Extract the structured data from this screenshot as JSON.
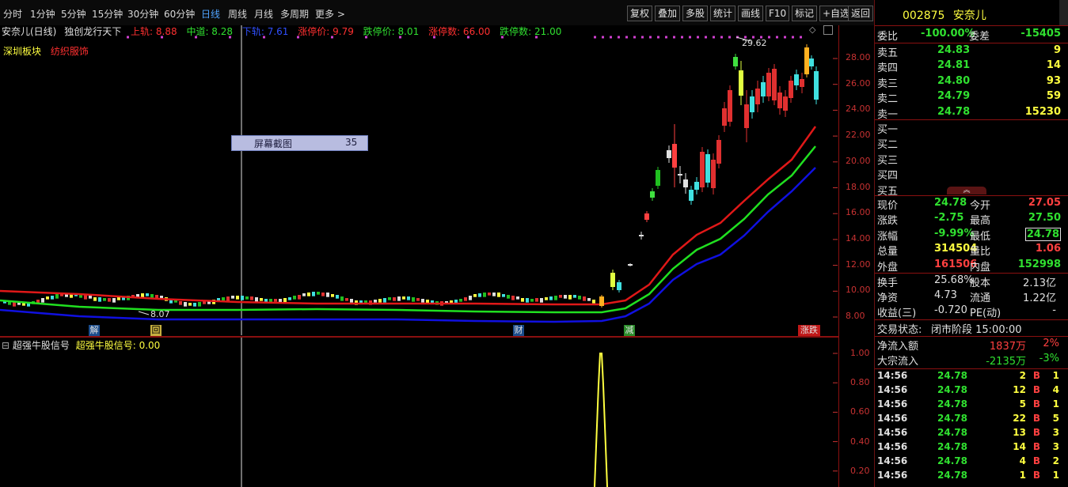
{
  "toolbar": {
    "periods": [
      "分时",
      "1分钟",
      "5分钟",
      "15分钟",
      "30分钟",
      "60分钟",
      "日线",
      "周线",
      "月线",
      "多周期",
      "更多 >"
    ],
    "active_period": "日线",
    "buttons": [
      "复权",
      "叠加",
      "多股",
      "统计",
      "画线",
      "F10",
      "标记",
      "+自选",
      "返回"
    ]
  },
  "chart_header": {
    "stock_label": "安奈儿(日线)",
    "indicator_name": "独创龙行天下",
    "upper_text": "上轨: 8.88",
    "middle_text": "中道: 8.28",
    "lower_text": "下轨: 7.61",
    "limit_up_price_text": "涨停价: 9.79",
    "limit_down_price_text": "跌停价: 8.01",
    "limit_up_count_text": "涨停数: 66.00",
    "limit_down_count_text": "跌停数: 21.00"
  },
  "sector_tags": [
    "深圳板块",
    "纺织服饰"
  ],
  "screenshot_tooltip": {
    "label": "屏幕截图",
    "value": "35"
  },
  "price_axis": [
    "28.00",
    "26.00",
    "24.00",
    "22.00",
    "20.00",
    "18.00",
    "16.00",
    "14.00",
    "12.00",
    "10.00",
    "8.00"
  ],
  "annotations": {
    "high_label": "29.62",
    "low_label": "8.07"
  },
  "event_markers": [
    "解",
    "回",
    "财",
    "减",
    "涨跌"
  ],
  "lower_indicator": {
    "title": "超强牛股信号",
    "value_text": "超强牛股信号: 0.00",
    "axis": [
      "1.00",
      "0.80",
      "0.60",
      "0.40",
      "0.20"
    ]
  },
  "quote": {
    "code": "002875",
    "name": "安奈儿",
    "weibi_label": "委比",
    "weibi_value": "-100.00%",
    "weicha_label": "委差",
    "weicha_value": "-15405",
    "asks": [
      {
        "label": "卖五",
        "price": "24.83",
        "vol": "9"
      },
      {
        "label": "卖四",
        "price": "24.81",
        "vol": "14"
      },
      {
        "label": "卖三",
        "price": "24.80",
        "vol": "93"
      },
      {
        "label": "卖二",
        "price": "24.79",
        "vol": "59"
      },
      {
        "label": "卖一",
        "price": "24.78",
        "vol": "15230"
      }
    ],
    "bids": [
      {
        "label": "买一"
      },
      {
        "label": "买二"
      },
      {
        "label": "买三"
      },
      {
        "label": "买四"
      },
      {
        "label": "买五"
      }
    ],
    "stats": [
      {
        "l1": "现价",
        "v1": "24.78",
        "l2": "今开",
        "v2": "27.05"
      },
      {
        "l1": "涨跌",
        "v1": "-2.75",
        "l2": "最高",
        "v2": "27.50"
      },
      {
        "l1": "涨幅",
        "v1": "-9.99%",
        "l2": "最低",
        "v2": "24.78"
      },
      {
        "l1": "总量",
        "v1": "314504",
        "l2": "量比",
        "v2": "1.06"
      },
      {
        "l1": "外盘",
        "v1": "161506",
        "l2": "内盘",
        "v2": "152998"
      }
    ],
    "stats2": [
      {
        "l1": "换手",
        "v1": "25.68%",
        "l2": "股本",
        "v2": "2.13亿"
      },
      {
        "l1": "净资",
        "v1": "4.73",
        "l2": "流通",
        "v2": "1.22亿"
      },
      {
        "l1": "收益(三)",
        "v1": "-0.720",
        "l2": "PE(动)",
        "v2": "-"
      }
    ],
    "trade_status_label": "交易状态:",
    "trade_status_value": "闭市阶段 15:00:00",
    "flows": [
      {
        "label": "净流入额",
        "value": "1837万",
        "pct": "2%"
      },
      {
        "label": "大宗流入",
        "value": "-2135万",
        "pct": "-3%"
      }
    ],
    "ticks": [
      {
        "time": "14:56",
        "price": "24.78",
        "vol": "2",
        "side": "B",
        "n": "1"
      },
      {
        "time": "14:56",
        "price": "24.78",
        "vol": "12",
        "side": "B",
        "n": "4"
      },
      {
        "time": "14:56",
        "price": "24.78",
        "vol": "5",
        "side": "B",
        "n": "1"
      },
      {
        "time": "14:56",
        "price": "24.78",
        "vol": "22",
        "side": "B",
        "n": "5"
      },
      {
        "time": "14:56",
        "price": "24.78",
        "vol": "13",
        "side": "B",
        "n": "3"
      },
      {
        "time": "14:56",
        "price": "24.78",
        "vol": "14",
        "side": "B",
        "n": "3"
      },
      {
        "time": "14:56",
        "price": "24.78",
        "vol": "4",
        "side": "B",
        "n": "2"
      },
      {
        "time": "14:56",
        "price": "24.78",
        "vol": "1",
        "side": "B",
        "n": "1"
      }
    ]
  }
}
